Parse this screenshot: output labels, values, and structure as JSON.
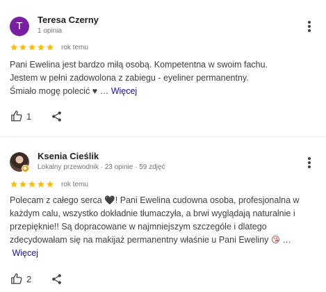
{
  "reviews": [
    {
      "avatar_letter": "T",
      "avatar_color": "#7b1fa2",
      "name": "Teresa Czerny",
      "meta": "1 opinia",
      "rating": 5,
      "date": "rok temu",
      "text_lines": [
        "Pani Ewelina jest bardzo miłą osobą. Kompetentna w swoim fachu.",
        "Jestem w pełni zadowolona z zabiegu - eyeliner permanentny.",
        "Śmiało mogę polecić ♥ … "
      ],
      "more_label": "Więcej",
      "like_count": "1"
    },
    {
      "name": "Ksenia Cieślik",
      "meta": "Lokalny przewodnik · 23 opinie · 59 zdjęć",
      "rating": 5,
      "date": "rok temu",
      "text_lines": [
        "Polecam z całego serca ",
        "każdym calu, wszystko dokładnie tłumaczyła, a brwi wyglądają naturalnie i",
        "przepięknie!! Są dopracowane w najmniejszym szczególe i dlatego",
        "zdecydowałam się na makijaż permanentny właśnie u Pani Eweliny "
      ],
      "line1_tail": "! Pani Ewelina cudowna osoba, profesjonalna w",
      "heart_emoji": "🖤",
      "face_emoji": "😘",
      "ellipsis": " …",
      "more_label": "Więcej",
      "like_count": "2"
    }
  ],
  "icons": {
    "star": "star-icon",
    "more": "more-vert-icon",
    "like": "thumb-up-icon",
    "share": "share-icon"
  },
  "colors": {
    "star": "#fbbc04",
    "link": "#1a0dab",
    "avatar_bg": "#7b1fa2",
    "guide_badge": "#f29900"
  }
}
